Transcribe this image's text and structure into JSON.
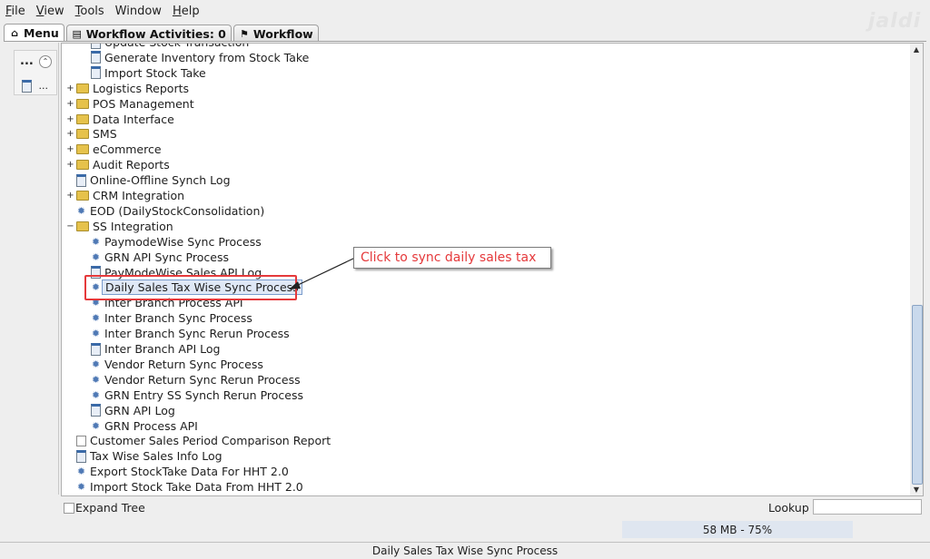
{
  "menu": [
    {
      "pre": "",
      "u": "F",
      "post": "ile"
    },
    {
      "pre": "",
      "u": "V",
      "post": "iew"
    },
    {
      "pre": "",
      "u": "T",
      "post": "ools"
    },
    {
      "pre": "Window",
      "u": "",
      "post": ""
    },
    {
      "pre": "",
      "u": "H",
      "post": "elp"
    }
  ],
  "logo": "jaldi",
  "tabs": [
    {
      "label": "Menu",
      "icon": "home-icon",
      "glyph": "⌂"
    },
    {
      "label": "Workflow Activities: 0",
      "icon": "list-icon",
      "glyph": "▤"
    },
    {
      "label": "Workflow",
      "icon": "workflow-icon",
      "glyph": "⚑"
    }
  ],
  "left_panel": {
    "dots": "...",
    "collapse_glyph": "⌃",
    "item_label": "..."
  },
  "tree": [
    {
      "label": "Update Stock Transaction",
      "icon": "doc",
      "level": 2,
      "exp": ""
    },
    {
      "label": "Generate Inventory from Stock Take",
      "icon": "doc",
      "level": 2,
      "exp": ""
    },
    {
      "label": "Import Stock Take",
      "icon": "doc",
      "level": 2,
      "exp": ""
    },
    {
      "label": "Logistics Reports",
      "icon": "folder",
      "level": 1,
      "exp": "+"
    },
    {
      "label": "POS Management",
      "icon": "folder",
      "level": 1,
      "exp": "+"
    },
    {
      "label": "Data Interface",
      "icon": "folder",
      "level": 1,
      "exp": "+"
    },
    {
      "label": "SMS",
      "icon": "folder",
      "level": 1,
      "exp": "+"
    },
    {
      "label": "eCommerce",
      "icon": "folder",
      "level": 1,
      "exp": "+"
    },
    {
      "label": "Audit Reports",
      "icon": "folder",
      "level": 1,
      "exp": "+"
    },
    {
      "label": "Online-Offline Synch Log",
      "icon": "doc",
      "level": 1,
      "exp": ""
    },
    {
      "label": "CRM Integration",
      "icon": "folder",
      "level": 1,
      "exp": "+"
    },
    {
      "label": "EOD (DailyStockConsolidation)",
      "icon": "cog",
      "level": 1,
      "exp": ""
    },
    {
      "label": "SS Integration",
      "icon": "folder",
      "level": 1,
      "exp": "−"
    },
    {
      "label": "PaymodeWise Sync Process",
      "icon": "cog",
      "level": 2,
      "exp": ""
    },
    {
      "label": "GRN API Sync Process",
      "icon": "cog",
      "level": 2,
      "exp": ""
    },
    {
      "label": "PayModeWise Sales API Log",
      "icon": "doc",
      "level": 2,
      "exp": ""
    },
    {
      "label": "Daily Sales Tax Wise Sync Process",
      "icon": "cog",
      "level": 2,
      "exp": "",
      "selected": true
    },
    {
      "label": "Inter Branch Process API",
      "icon": "cog",
      "level": 2,
      "exp": ""
    },
    {
      "label": "Inter Branch Sync Process",
      "icon": "cog",
      "level": 2,
      "exp": ""
    },
    {
      "label": "Inter Branch Sync Rerun Process",
      "icon": "cog",
      "level": 2,
      "exp": ""
    },
    {
      "label": "Inter Branch API Log",
      "icon": "doc",
      "level": 2,
      "exp": ""
    },
    {
      "label": "Vendor Return Sync Process",
      "icon": "cog",
      "level": 2,
      "exp": ""
    },
    {
      "label": "Vendor Return Sync Rerun Process",
      "icon": "cog",
      "level": 2,
      "exp": ""
    },
    {
      "label": "GRN Entry SS Synch Rerun Process",
      "icon": "cog",
      "level": 2,
      "exp": ""
    },
    {
      "label": "GRN API Log",
      "icon": "doc",
      "level": 2,
      "exp": ""
    },
    {
      "label": "GRN Process API",
      "icon": "cog",
      "level": 2,
      "exp": ""
    },
    {
      "label": "Customer Sales Period Comparison Report",
      "icon": "report",
      "level": 1,
      "exp": ""
    },
    {
      "label": "Tax Wise Sales Info Log",
      "icon": "doc",
      "level": 1,
      "exp": ""
    },
    {
      "label": "Export StockTake Data For HHT 2.0",
      "icon": "cog",
      "level": 1,
      "exp": ""
    },
    {
      "label": "Import Stock Take Data From HHT 2.0",
      "icon": "cog",
      "level": 1,
      "exp": ""
    }
  ],
  "callout": {
    "text": "Click to sync daily sales tax",
    "color": "#e5393b"
  },
  "scroll": {
    "up": "▲",
    "down": "▼"
  },
  "bottom": {
    "expand_tree": "Expand Tree",
    "lookup": "Lookup",
    "lookup_value": ""
  },
  "memory": "58 MB - 75%",
  "status": "Daily Sales Tax Wise Sync Process"
}
